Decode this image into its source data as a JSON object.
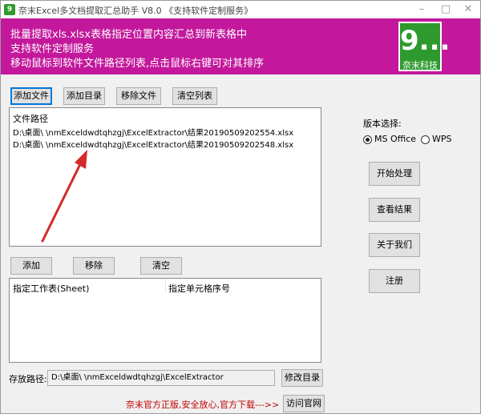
{
  "window": {
    "title": "奈末Excel多文档提取汇总助手 V8.0 《支持软件定制服务》"
  },
  "banner": {
    "line1": "批量提取xls.xlsx表格指定位置内容汇总到新表格中",
    "line2": "支持软件定制服务",
    "line3": "移动鼠标到软件文件路径列表,点击鼠标右键可对其排序",
    "logo_mark": "9...",
    "logo_text": "奈末科技"
  },
  "file_toolbar": {
    "add_file": "添加文件",
    "add_dir": "添加目录",
    "remove_file": "移除文件",
    "clear_list": "清空列表"
  },
  "file_list": {
    "header": "文件路径",
    "rows": [
      "D:\\桌面\\          \\nmExceldwdtqhzgj\\ExcelExtractor\\结果20190509202554.xlsx",
      "D:\\桌面\\          \\nmExceldwdtqhzgj\\ExcelExtractor\\结果20190509202548.xlsx"
    ]
  },
  "sheet_toolbar": {
    "add": "添加",
    "remove": "移除",
    "clear": "清空"
  },
  "sheet_list": {
    "col1": "指定工作表(Sheet)",
    "col2": "指定单元格序号"
  },
  "version": {
    "label": "版本选择:",
    "ms_office": "MS Office",
    "wps": "WPS",
    "selected": "MS Office"
  },
  "side_buttons": {
    "start": "开始处理",
    "view": "查看结果",
    "about": "关于我们",
    "register": "注册"
  },
  "save": {
    "label": "存放路径:",
    "path": "D:\\桌面\\          \\nmExceldwdtqhzgj\\ExcelExtractor",
    "modify": "修改目录"
  },
  "footer": {
    "notice": "奈末官方正版,安全放心,官方下载--->>",
    "visit": "访问官网"
  },
  "colors": {
    "banner": "#c3189c",
    "logo": "#2e9a2e",
    "arrow": "#d42a2a",
    "footer_text": "#c00000"
  }
}
